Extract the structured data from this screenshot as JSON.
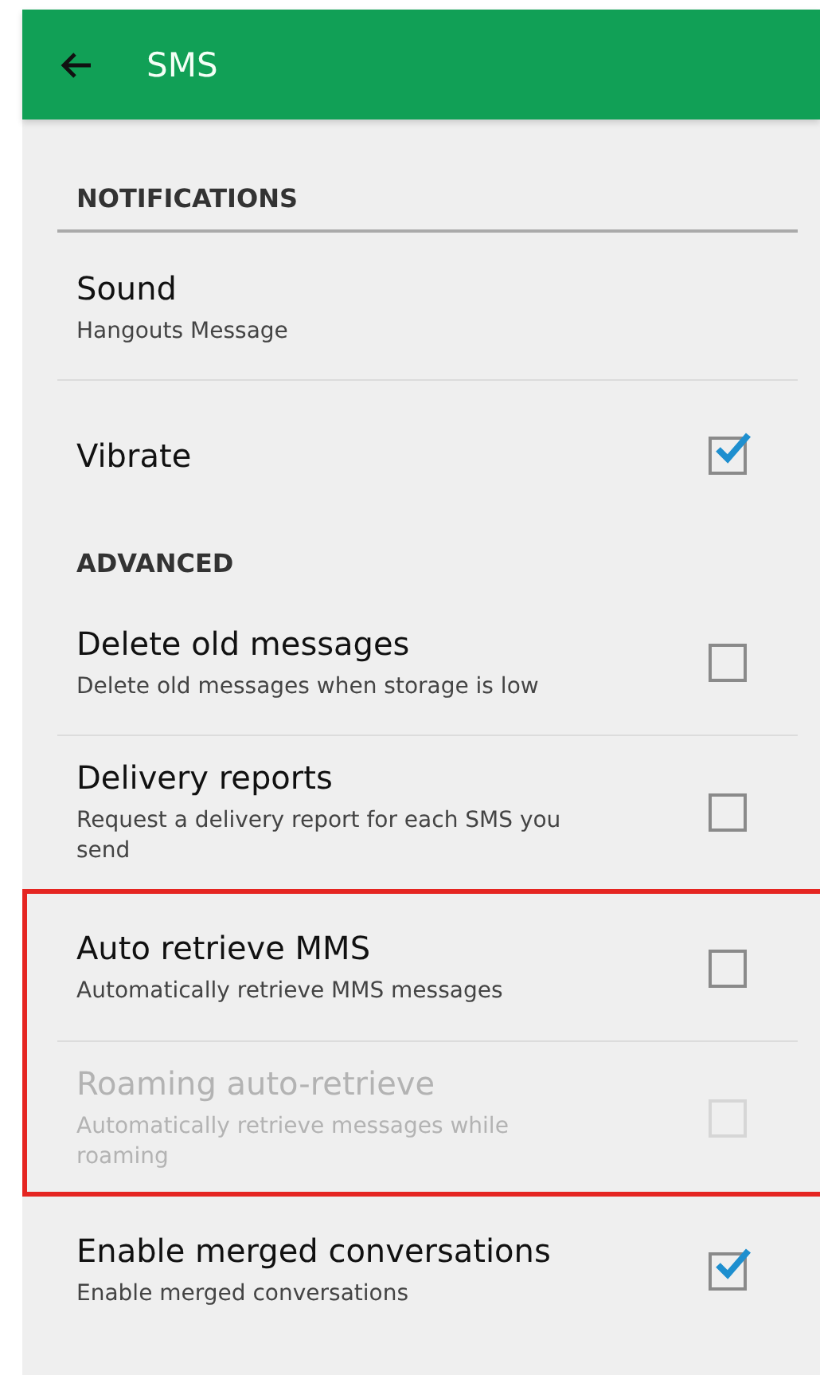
{
  "app_bar": {
    "back_icon": true,
    "title": "SMS"
  },
  "sections": [
    {
      "header": "NOTIFICATIONS",
      "items": [
        {
          "kind": "value",
          "title": "Sound",
          "summary": "Hangouts Message",
          "highlighted": false,
          "disabled": false
        },
        {
          "kind": "checkbox",
          "title": "Vibrate",
          "checked": true,
          "highlighted": false,
          "disabled": false
        }
      ]
    },
    {
      "header": "ADVANCED",
      "items": [
        {
          "kind": "checkbox",
          "title": "Delete old messages",
          "summary": "Delete old messages when storage is low",
          "checked": false,
          "highlighted": false,
          "disabled": false
        },
        {
          "kind": "checkbox",
          "title": "Delivery reports",
          "summary": "Request a delivery report for each SMS you send",
          "checked": false,
          "highlighted": false,
          "disabled": false
        },
        {
          "kind": "checkbox",
          "title": "Auto retrieve MMS",
          "summary": "Automatically retrieve MMS messages",
          "checked": false,
          "highlighted": true,
          "disabled": false
        },
        {
          "kind": "checkbox",
          "title": "Roaming auto-retrieve",
          "summary": "Automatically retrieve messages while roaming",
          "checked": false,
          "highlighted": true,
          "disabled": true
        },
        {
          "kind": "checkbox",
          "title": "Enable merged conversations",
          "summary": "Enable merged conversations",
          "checked": true,
          "highlighted": false,
          "disabled": false
        }
      ]
    }
  ]
}
